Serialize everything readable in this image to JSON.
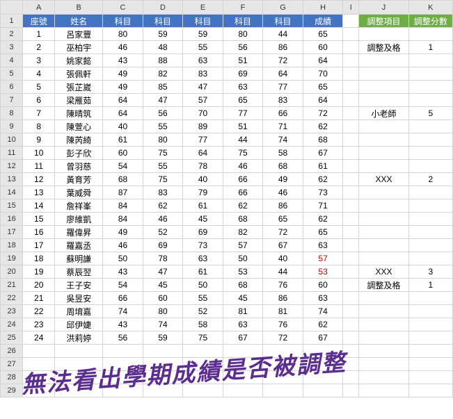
{
  "cols": [
    "A",
    "B",
    "C",
    "D",
    "E",
    "F",
    "G",
    "H",
    "I",
    "J",
    "K"
  ],
  "header": {
    "A": "座號",
    "B": "姓名",
    "C": "科目",
    "D": "科目",
    "E": "科目",
    "F": "科目",
    "G": "科目",
    "H": "成績",
    "J": "調整項目",
    "K": "調整分數"
  },
  "rows": [
    {
      "n": "1",
      "a": "1",
      "b": "呂家豐",
      "c": "80",
      "d": "59",
      "e": "59",
      "f": "80",
      "g": "44",
      "h": "65",
      "j": "",
      "k": ""
    },
    {
      "n": "2",
      "a": "2",
      "b": "巫柏宇",
      "c": "46",
      "d": "48",
      "e": "55",
      "f": "56",
      "g": "86",
      "h": "60",
      "j": "調整及格",
      "k": "1"
    },
    {
      "n": "3",
      "a": "3",
      "b": "姚家懿",
      "c": "43",
      "d": "88",
      "e": "63",
      "f": "51",
      "g": "72",
      "h": "64",
      "j": "",
      "k": ""
    },
    {
      "n": "4",
      "a": "4",
      "b": "張佩軒",
      "c": "49",
      "d": "82",
      "e": "83",
      "f": "69",
      "g": "64",
      "h": "70",
      "j": "",
      "k": ""
    },
    {
      "n": "5",
      "a": "5",
      "b": "張芷崴",
      "c": "49",
      "d": "85",
      "e": "47",
      "f": "63",
      "g": "77",
      "h": "65",
      "j": "",
      "k": ""
    },
    {
      "n": "6",
      "a": "6",
      "b": "梁雁茹",
      "c": "64",
      "d": "47",
      "e": "57",
      "f": "65",
      "g": "83",
      "h": "64",
      "j": "",
      "k": ""
    },
    {
      "n": "7",
      "a": "7",
      "b": "陳晴筑",
      "c": "64",
      "d": "56",
      "e": "70",
      "f": "77",
      "g": "66",
      "h": "72",
      "j": "小老師",
      "k": "5"
    },
    {
      "n": "8",
      "a": "8",
      "b": "陳萱心",
      "c": "40",
      "d": "55",
      "e": "89",
      "f": "51",
      "g": "71",
      "h": "62",
      "j": "",
      "k": ""
    },
    {
      "n": "9",
      "a": "9",
      "b": "陳芮綺",
      "c": "61",
      "d": "80",
      "e": "77",
      "f": "44",
      "g": "74",
      "h": "68",
      "j": "",
      "k": ""
    },
    {
      "n": "10",
      "a": "10",
      "b": "彭子欣",
      "c": "60",
      "d": "75",
      "e": "64",
      "f": "75",
      "g": "58",
      "h": "67",
      "j": "",
      "k": ""
    },
    {
      "n": "11",
      "a": "11",
      "b": "曾羽慈",
      "c": "54",
      "d": "55",
      "e": "78",
      "f": "46",
      "g": "68",
      "h": "61",
      "j": "",
      "k": ""
    },
    {
      "n": "12",
      "a": "12",
      "b": "黃育芳",
      "c": "68",
      "d": "75",
      "e": "40",
      "f": "66",
      "g": "49",
      "h": "62",
      "j": "XXX",
      "k": "2"
    },
    {
      "n": "13",
      "a": "13",
      "b": "葉威舜",
      "c": "87",
      "d": "83",
      "e": "79",
      "f": "66",
      "g": "46",
      "h": "73",
      "j": "",
      "k": ""
    },
    {
      "n": "14",
      "a": "14",
      "b": "詹祥峯",
      "c": "84",
      "d": "62",
      "e": "61",
      "f": "62",
      "g": "86",
      "h": "71",
      "j": "",
      "k": ""
    },
    {
      "n": "15",
      "a": "15",
      "b": "廖維凱",
      "c": "84",
      "d": "46",
      "e": "45",
      "f": "68",
      "g": "65",
      "h": "62",
      "j": "",
      "k": ""
    },
    {
      "n": "16",
      "a": "16",
      "b": "羅偉昇",
      "c": "49",
      "d": "52",
      "e": "69",
      "f": "82",
      "g": "72",
      "h": "65",
      "j": "",
      "k": ""
    },
    {
      "n": "17",
      "a": "17",
      "b": "羅嘉丞",
      "c": "46",
      "d": "69",
      "e": "73",
      "f": "57",
      "g": "67",
      "h": "63",
      "j": "",
      "k": ""
    },
    {
      "n": "18",
      "a": "18",
      "b": "蘇明謙",
      "c": "50",
      "d": "78",
      "e": "63",
      "f": "50",
      "g": "40",
      "h": "57",
      "hred": true,
      "j": "",
      "k": ""
    },
    {
      "n": "19",
      "a": "19",
      "b": "蔡辰翌",
      "c": "43",
      "d": "47",
      "e": "61",
      "f": "53",
      "g": "44",
      "h": "53",
      "hred": true,
      "j": "XXX",
      "k": "3"
    },
    {
      "n": "20",
      "a": "20",
      "b": "王子安",
      "c": "54",
      "d": "45",
      "e": "50",
      "f": "68",
      "g": "76",
      "h": "60",
      "j": "調整及格",
      "k": "1"
    },
    {
      "n": "21",
      "a": "21",
      "b": "吳昱安",
      "c": "66",
      "d": "60",
      "e": "55",
      "f": "45",
      "g": "86",
      "h": "63",
      "j": "",
      "k": ""
    },
    {
      "n": "22",
      "a": "22",
      "b": "周堉嘉",
      "c": "74",
      "d": "80",
      "e": "52",
      "f": "81",
      "g": "81",
      "h": "74",
      "j": "",
      "k": ""
    },
    {
      "n": "23",
      "a": "23",
      "b": "邱伊婕",
      "c": "43",
      "d": "74",
      "e": "58",
      "f": "63",
      "g": "76",
      "h": "62",
      "j": "",
      "k": ""
    },
    {
      "n": "24",
      "a": "24",
      "b": "洪莉婷",
      "c": "56",
      "d": "59",
      "e": "75",
      "f": "67",
      "g": "72",
      "h": "67",
      "j": "",
      "k": ""
    }
  ],
  "empty": [
    "26",
    "27",
    "28",
    "29"
  ],
  "overlay": "無法看出學期成績是否被調整"
}
